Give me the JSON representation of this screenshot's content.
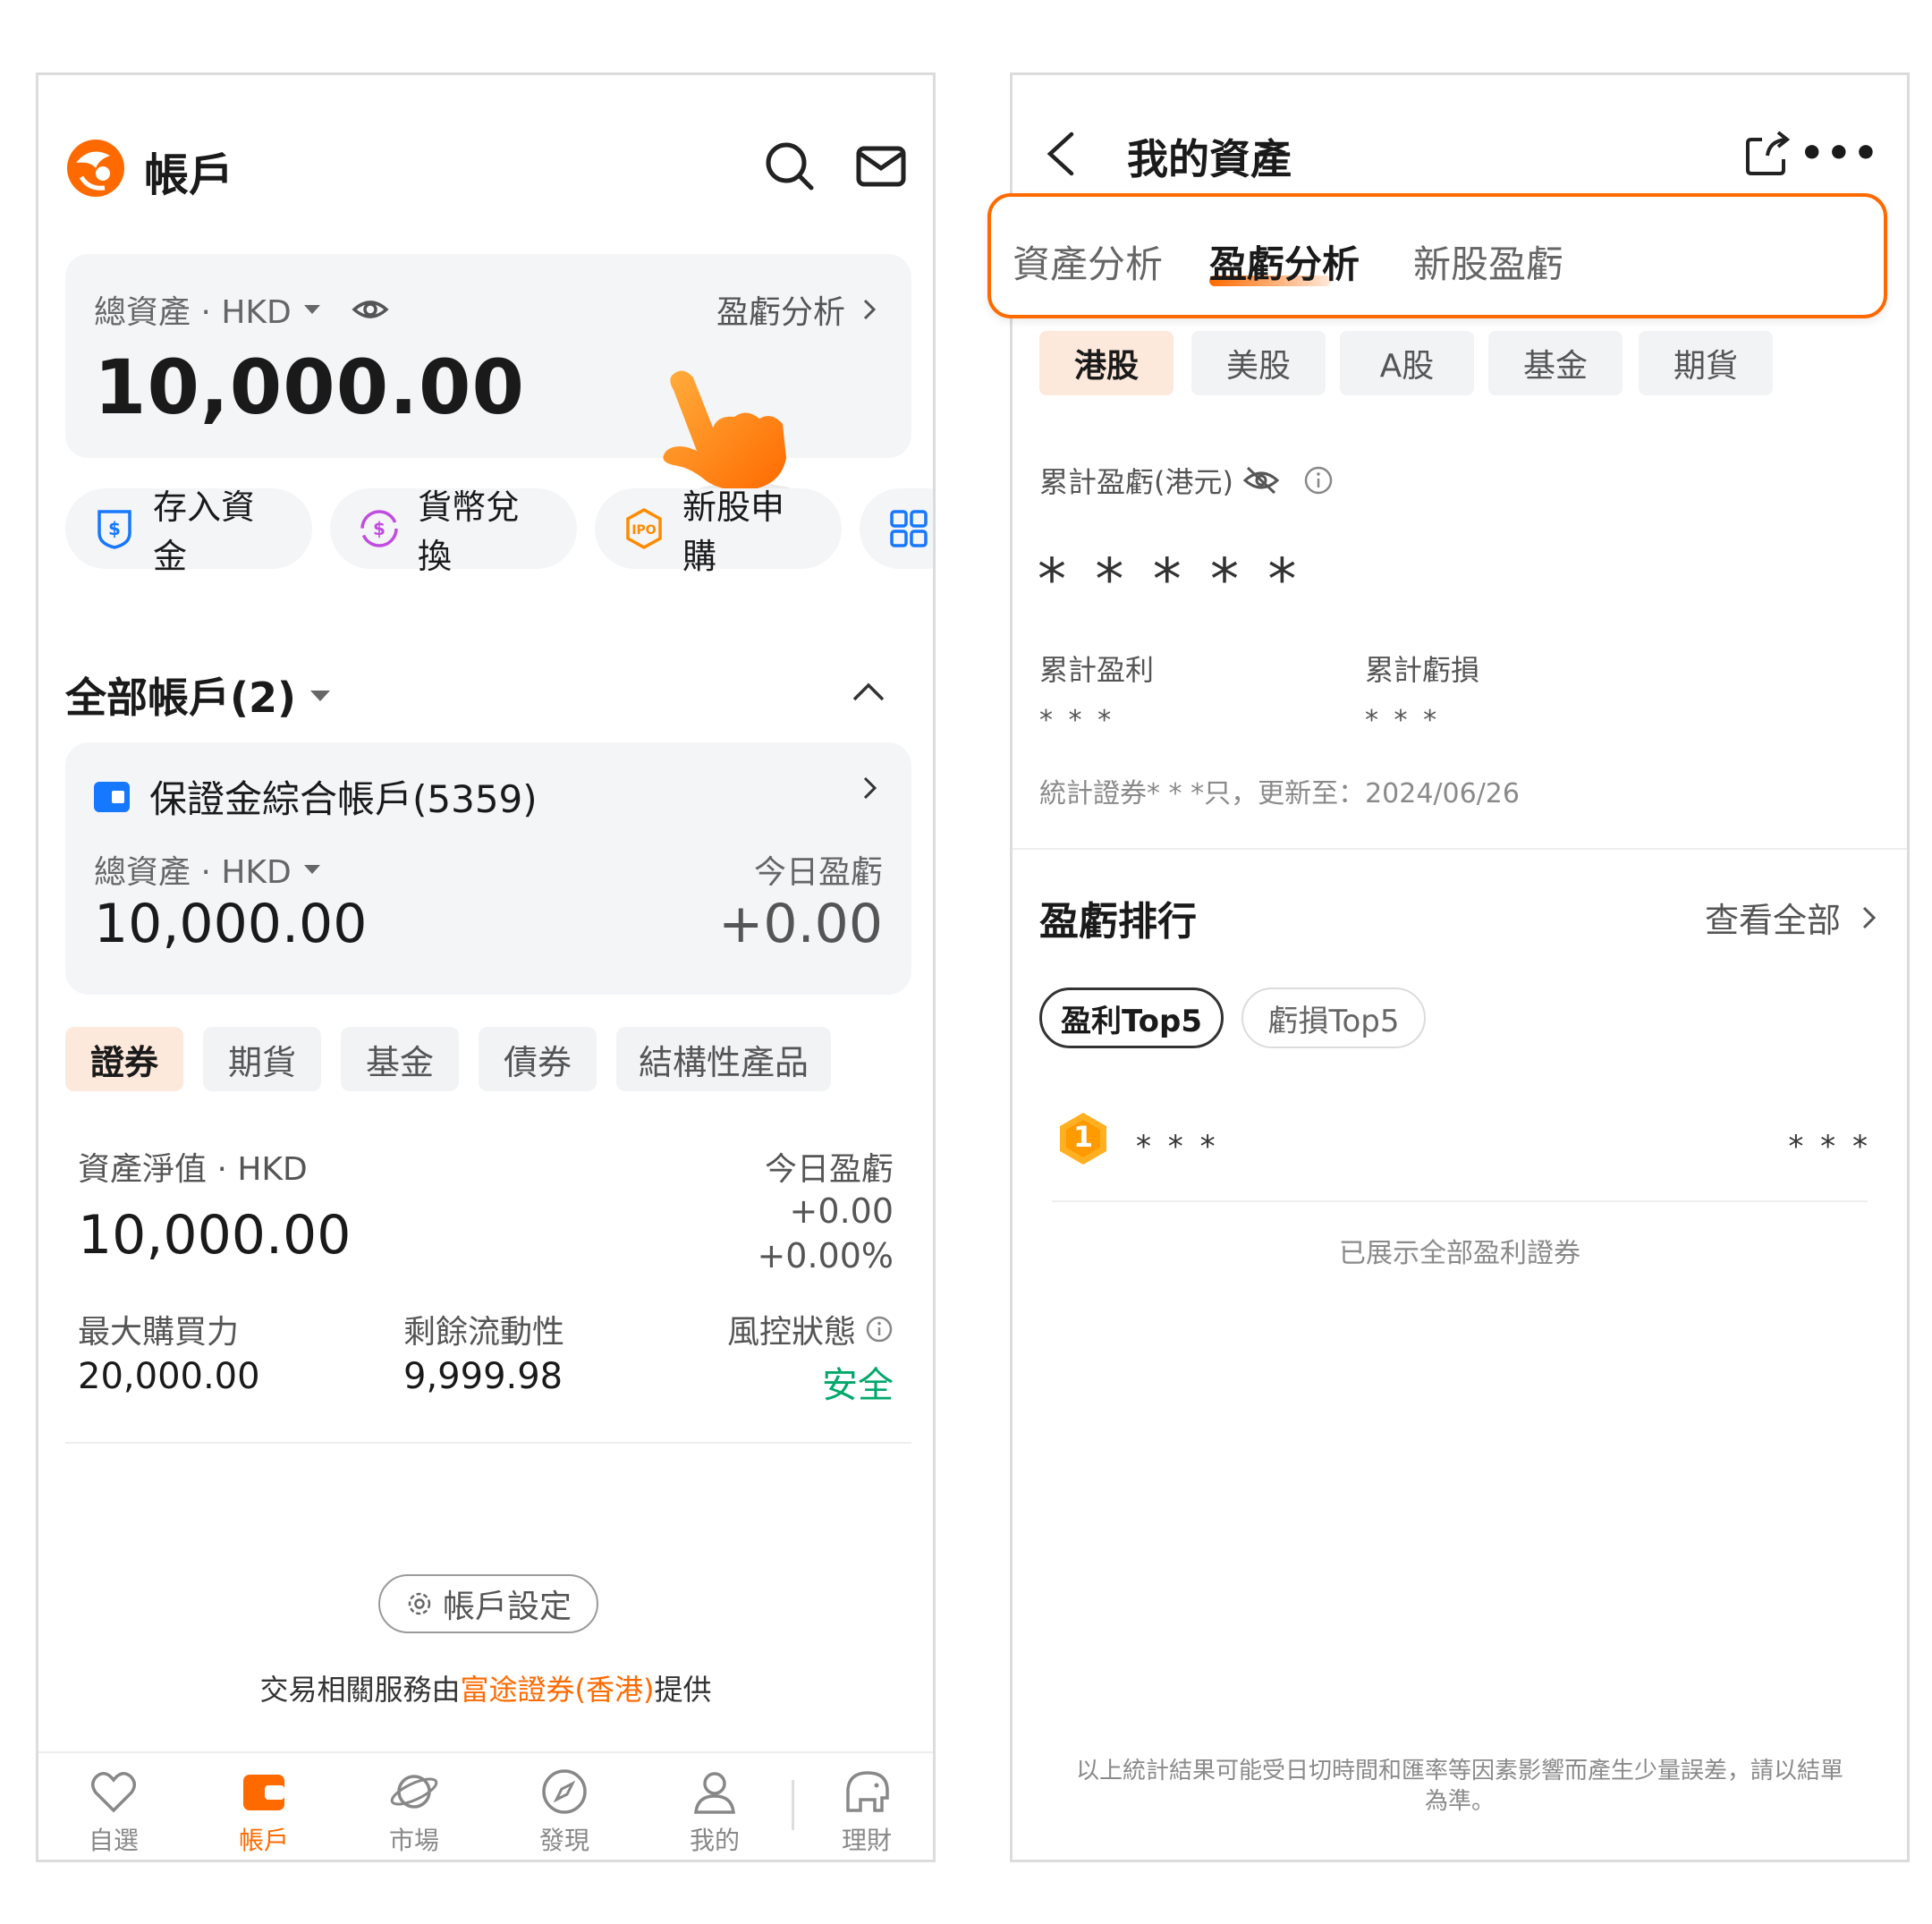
{
  "left": {
    "header": {
      "title": "帳戶"
    },
    "total_assets": {
      "label": "總資產 · HKD",
      "link": "盈虧分析",
      "value": "10,000.00"
    },
    "actions": [
      "存入資金",
      "貨幣兌換",
      "新股申購"
    ],
    "accounts_title": "全部帳戶(2)",
    "account_card": {
      "name": "保證金綜合帳戶(5359)",
      "assets_label": "總資產 · HKD",
      "today_label": "今日盈虧",
      "value": "10,000.00",
      "today_pl": "+0.00"
    },
    "product_tabs": [
      "證券",
      "期貨",
      "基金",
      "債券",
      "結構性產品"
    ],
    "net": {
      "label": "資產淨值 · HKD",
      "today_label": "今日盈虧",
      "value": "10,000.00",
      "pl": "+0.00",
      "pl_pct": "+0.00%"
    },
    "stats": {
      "buying_power_label": "最大購買力",
      "buying_power": "20,000.00",
      "liquidity_label": "剩餘流動性",
      "liquidity": "9,999.98",
      "risk_label": "風控狀態",
      "risk": "安全"
    },
    "settings_button": "帳戶設定",
    "provider": {
      "prefix": "交易相關服務由",
      "name": "富途證券(香港)",
      "suffix": "提供"
    },
    "nav": [
      "自選",
      "帳戶",
      "市場",
      "發現",
      "我的",
      "理財"
    ],
    "accent": "#ff6a00",
    "safe_color": "#00a86b"
  },
  "right": {
    "header": {
      "title": "我的資產"
    },
    "tabs": [
      "資產分析",
      "盈虧分析",
      "新股盈虧"
    ],
    "markets": [
      "港股",
      "美股",
      "A股",
      "基金",
      "期貨"
    ],
    "cumulative_label": "累計盈虧(港元)",
    "cumulative_value": "* * * * *",
    "profit_label": "累計盈利",
    "profit_value": "* * *",
    "loss_label": "累計虧損",
    "loss_value": "* * *",
    "stat_note": "統計證券* * *只，更新至：2024/06/26",
    "ranking_title": "盈虧排行",
    "view_all": "查看全部",
    "ranking_tabs": [
      "盈利Top5",
      "虧損Top5"
    ],
    "rank_items": [
      {
        "rank": "1",
        "name": "* * *",
        "value": "* * *"
      }
    ],
    "shown_all": "已展示全部盈利證券",
    "disclaimer": "以上統計結果可能受日切時間和匯率等因素影響而產生少量誤差，請以結單為準。"
  }
}
